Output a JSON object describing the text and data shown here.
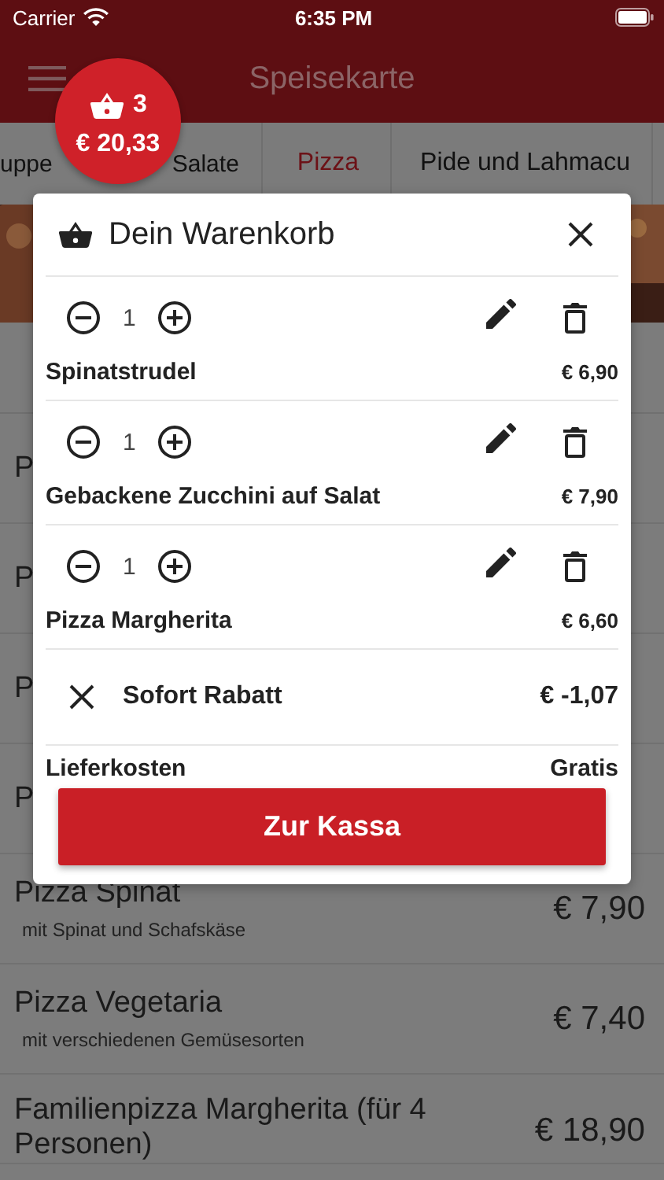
{
  "status_bar": {
    "carrier": "Carrier",
    "time": "6:35 PM"
  },
  "nav": {
    "title": "Speisekarte"
  },
  "cart_badge": {
    "count": "3",
    "total": "€ 20,33"
  },
  "tabs": [
    {
      "labels": [
        "uppe",
        "Salate"
      ],
      "selected": false
    },
    {
      "labels": [
        "Pizza"
      ],
      "selected": true
    },
    {
      "labels": [
        "Pide und Lahmacu"
      ],
      "selected": false
    }
  ],
  "menu": {
    "items": [
      {
        "name": "P"
      },
      {
        "name": "P"
      },
      {
        "name": "P"
      },
      {
        "name": "P"
      },
      {
        "name": "Pizza Spinat",
        "description": "mit Spinat und Schafskäse",
        "price": "€ 7,90"
      },
      {
        "name": "Pizza Vegetaria",
        "description": "mit verschiedenen Gemüsesorten",
        "price": "€ 7,40"
      },
      {
        "name": "Familienpizza Margherita (für 4 Personen)",
        "price": "€ 18,90"
      }
    ]
  },
  "cart": {
    "title": "Dein Warenkorb",
    "items": [
      {
        "quantity": "1",
        "name": "Spinatstrudel",
        "price": "€ 6,90"
      },
      {
        "quantity": "1",
        "name": "Gebackene Zucchini auf Salat",
        "price": "€ 7,90"
      },
      {
        "quantity": "1",
        "name": "Pizza Margherita",
        "price": "€ 6,60"
      }
    ],
    "discount": {
      "label": "Sofort Rabatt",
      "amount": "€ -1,07"
    },
    "delivery": {
      "label": "Lieferkosten",
      "value": "Gratis"
    },
    "checkout_button": "Zur Kassa"
  }
}
